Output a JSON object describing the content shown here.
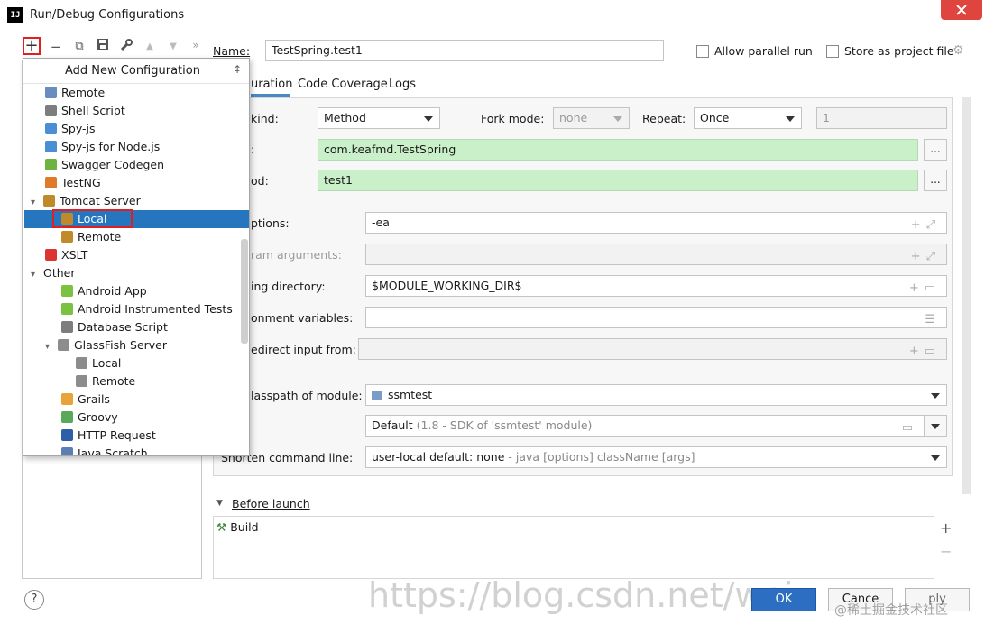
{
  "window": {
    "title": "Run/Debug Configurations",
    "app_icon_text": "IJ"
  },
  "toolbar": {
    "add": "+",
    "remove": "−",
    "copy": "⧉",
    "save": "💾",
    "edit": "🔧",
    "up": "▲",
    "down": "▼",
    "more": "»"
  },
  "popup": {
    "title": "Add New Configuration",
    "items": [
      {
        "label": "Remote",
        "icon": "remote-icon",
        "color": "#6a8cbf"
      },
      {
        "label": "Shell Script",
        "icon": "shell-script-icon",
        "color": "#7d7d7d"
      },
      {
        "label": "Spy-js",
        "icon": "spy-js-icon",
        "color": "#4a8fd6"
      },
      {
        "label": "Spy-js for Node.js",
        "icon": "spy-js-node-icon",
        "color": "#4a8fd6"
      },
      {
        "label": "Swagger Codegen",
        "icon": "swagger-icon",
        "color": "#6cb43f"
      },
      {
        "label": "TestNG",
        "icon": "testng-icon",
        "color": "#e07a2a"
      },
      {
        "label": "Tomcat Server",
        "icon": "tomcat-icon",
        "color": "#c08a2a"
      },
      {
        "label": "Local",
        "icon": "tomcat-local-icon",
        "color": "#c08a2a"
      },
      {
        "label": "Remote",
        "icon": "tomcat-remote-icon",
        "color": "#c08a2a"
      },
      {
        "label": "XSLT",
        "icon": "xslt-icon",
        "color": "#d33"
      },
      {
        "label": "Other",
        "icon": "",
        "color": ""
      },
      {
        "label": "Android App",
        "icon": "android-icon",
        "color": "#7cc242"
      },
      {
        "label": "Android Instrumented Tests",
        "icon": "android-test-icon",
        "color": "#7cc242"
      },
      {
        "label": "Database Script",
        "icon": "database-icon",
        "color": "#7d7d7d"
      },
      {
        "label": "GlassFish Server",
        "icon": "glassfish-icon",
        "color": "#8c8c8c"
      },
      {
        "label": "Local",
        "icon": "glassfish-local-icon",
        "color": "#8c8c8c"
      },
      {
        "label": "Remote",
        "icon": "glassfish-remote-icon",
        "color": "#8c8c8c"
      },
      {
        "label": "Grails",
        "icon": "grails-icon",
        "color": "#e8a33b"
      },
      {
        "label": "Groovy",
        "icon": "groovy-icon",
        "color": "#5aa95a"
      },
      {
        "label": "HTTP Request",
        "icon": "http-api-icon",
        "color": "#2f5ea8"
      },
      {
        "label": "Java Scratch",
        "icon": "java-scratch-icon",
        "color": "#5b7fb5"
      }
    ]
  },
  "form": {
    "name_label": "Name:",
    "name_value": "TestSpring.test1",
    "allow_parallel": "Allow parallel run",
    "store_project": "Store as project file",
    "tabs": [
      "uration",
      "Code Coverage",
      "Logs"
    ],
    "kind_label": "kind:",
    "kind_value": "Method",
    "fork_label": "Fork mode:",
    "fork_value": "none",
    "repeat_label": "Repeat:",
    "repeat_value": "Once",
    "repeat_count": "1",
    "class_label": ":",
    "class_value": "com.keafmd.TestSpring",
    "method_label": "od:",
    "method_value": "test1",
    "browse": "...",
    "vm_label": "ptions:",
    "vm_value": "-ea",
    "program_args_label": "ram arguments:",
    "workdir_label": "ing directory:",
    "workdir_value": "$MODULE_WORKING_DIR$",
    "env_label": "onment variables:",
    "redirect_label": "edirect input from:",
    "classpath_label": "lasspath of module:",
    "classpath_value": "ssmtest",
    "jre_value": "Default",
    "jre_hint": "(1.8 - SDK of 'ssmtest' module)",
    "shorten_label": "Shorten command line:",
    "shorten_value": "user-local default: none",
    "shorten_hint": "- java [options] className [args]",
    "before_launch": "Before launch",
    "build": "Build"
  },
  "buttons": {
    "help": "?",
    "ok": "OK",
    "cancel": "Cance",
    "apply": "ply"
  },
  "watermark": {
    "url": "https://blog.csdn.net/wei",
    "site": "@稀土掘金技术社区"
  }
}
